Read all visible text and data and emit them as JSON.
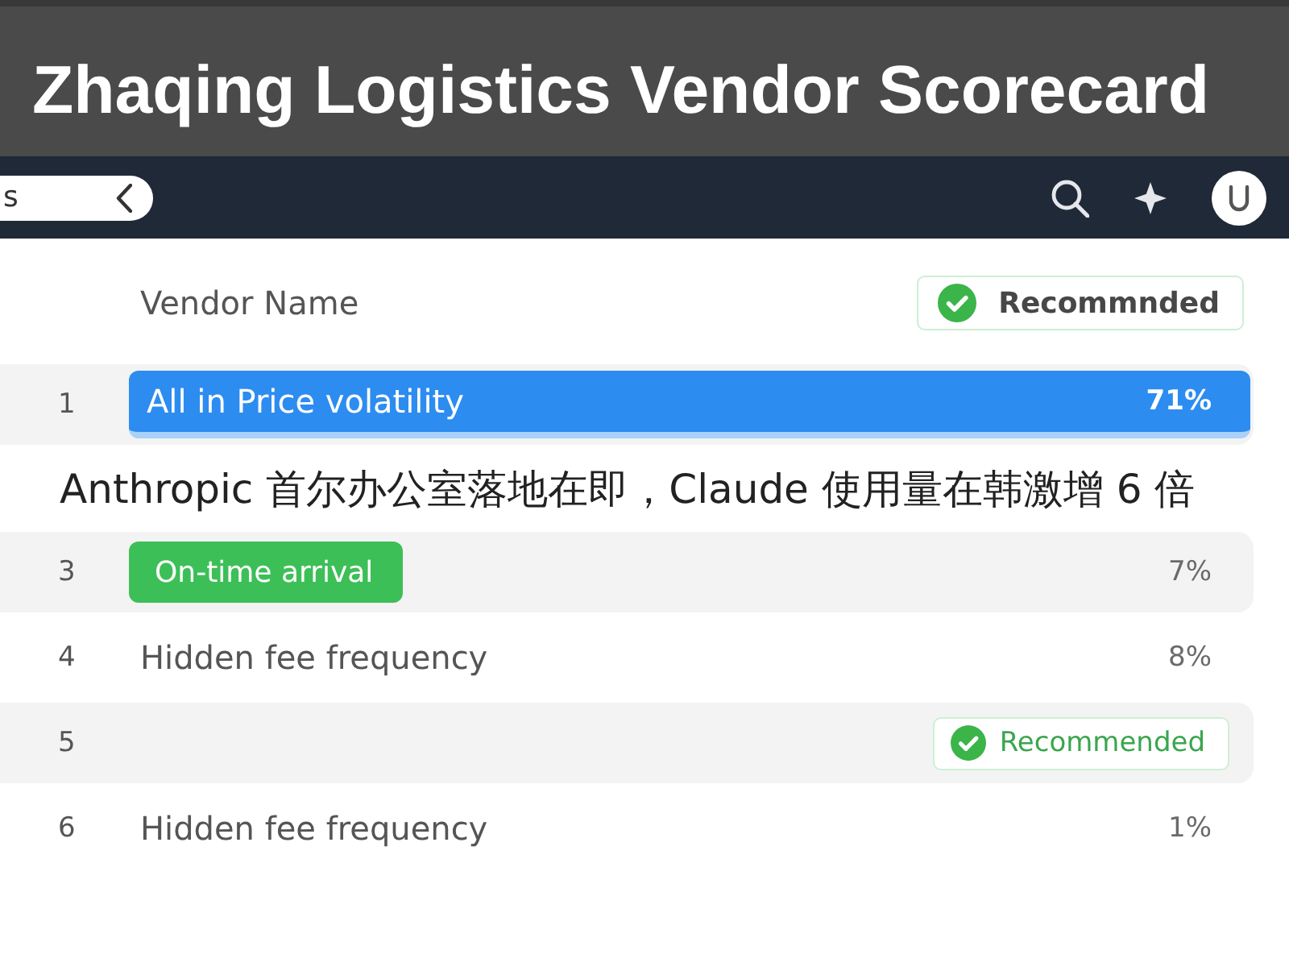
{
  "window": {
    "title": "Zhaqing Logistics Vendor Scorecard"
  },
  "toolbar": {
    "toggle_label": "s"
  },
  "table": {
    "header": {
      "label": "Vendor Name",
      "badge": "Recommnded"
    },
    "rows": [
      {
        "index": "1",
        "kind": "text",
        "name": "All in Price volatility",
        "value": "71%",
        "selected": true,
        "shaded": true
      },
      {
        "index": "3",
        "kind": "tag",
        "name": "On-time arrival",
        "value": "7%",
        "selected": false,
        "shaded": true
      },
      {
        "index": "4",
        "kind": "text",
        "name": "Hidden fee frequency",
        "value": "8%",
        "selected": false,
        "shaded": false
      },
      {
        "index": "5",
        "kind": "badge",
        "badge": "Recommended",
        "selected": false,
        "shaded": true
      },
      {
        "index": "6",
        "kind": "text",
        "name": "Hidden fee frequency",
        "value": "1%",
        "selected": false,
        "shaded": false
      }
    ]
  },
  "caption": "Anthropic 首尔办公室落地在即，Claude 使用量在韩激增 6 倍"
}
